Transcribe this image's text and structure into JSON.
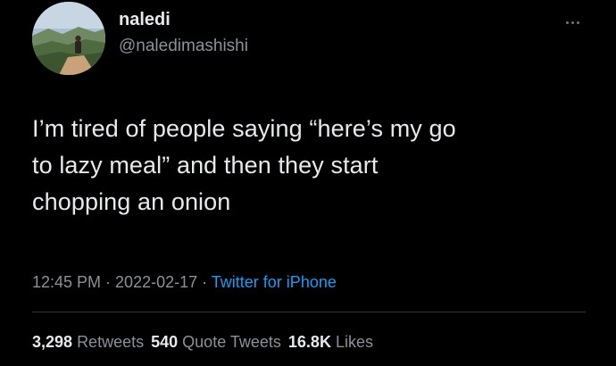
{
  "user": {
    "display_name": "naledi",
    "handle": "@naledimashishi",
    "avatar_icon": "avatar-landscape-photo"
  },
  "tweet": {
    "lines": [
      "I’m tired of people saying “here’s my go",
      "to lazy meal” and then they start",
      "chopping an onion"
    ]
  },
  "meta": {
    "time": "12:45 PM",
    "sep1": " · ",
    "date": "2022-02-17",
    "sep2": " · ",
    "source": "Twitter for iPhone"
  },
  "stats": {
    "retweets_count": "3,298",
    "retweets_label": "Retweets",
    "quotes_count": "540",
    "quotes_label": "Quote Tweets",
    "likes_count": "16.8K",
    "likes_label": "Likes"
  },
  "colors": {
    "background": "#000000",
    "text_primary": "#e7e9ea",
    "text_secondary": "#8b9196",
    "link": "#1d9bf0",
    "divider": "#2f3336"
  }
}
